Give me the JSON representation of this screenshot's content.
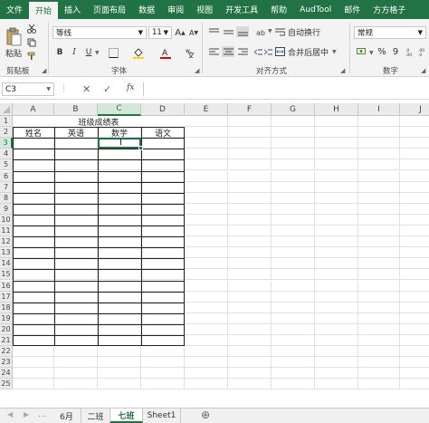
{
  "ribbon_tabs": [
    "文件",
    "开始",
    "插入",
    "页面布局",
    "数据",
    "审阅",
    "视图",
    "开发工具",
    "帮助",
    "AudTool",
    "邮件",
    "方方格子"
  ],
  "clipboard": {
    "paste_label": "粘贴",
    "group_label": "剪贴板"
  },
  "font": {
    "name": "等线",
    "size": "11",
    "bold": "B",
    "italic": "I",
    "underline": "U",
    "grow": "A",
    "shrink": "A",
    "group_label": "字体"
  },
  "alignment": {
    "wrap_label": "自动换行",
    "merge_label": "合并后居中",
    "group_label": "对齐方式"
  },
  "number": {
    "format": "常规",
    "percent": "%",
    "comma": "9",
    "group_label": "数字"
  },
  "formula_bar": {
    "name_box": "C3",
    "fx": "fx",
    "formula": ""
  },
  "columns": [
    "A",
    "B",
    "C",
    "D",
    "E",
    "F",
    "G",
    "H",
    "I",
    "J"
  ],
  "rows": [
    "1",
    "2",
    "3",
    "4",
    "5",
    "6",
    "7",
    "8",
    "9",
    "10",
    "11",
    "12",
    "13",
    "14",
    "15",
    "16",
    "17",
    "18",
    "19",
    "20",
    "21",
    "22",
    "23",
    "24",
    "25"
  ],
  "table": {
    "title": "班级成绩表",
    "headers": [
      "姓名",
      "英语",
      "数学",
      "语文"
    ]
  },
  "active_cell": "C3",
  "sheets": [
    "6月",
    "二班",
    "七班",
    "Sheet1"
  ],
  "active_sheet": "七班",
  "colors": {
    "brand": "#217346",
    "selected_header": "#d3e8da"
  }
}
